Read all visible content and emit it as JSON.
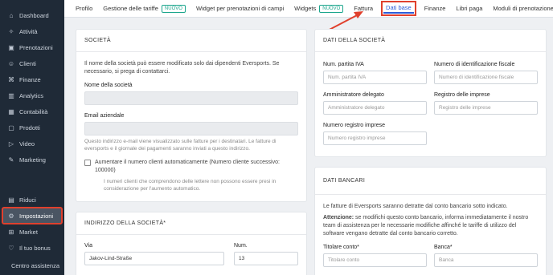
{
  "sidebar": {
    "items": [
      {
        "icon": "dashboard-icon",
        "glyph": "⌂",
        "label": "Dashboard"
      },
      {
        "icon": "activity-icon",
        "glyph": "✧",
        "label": "Attività"
      },
      {
        "icon": "calendar-icon",
        "glyph": "▣",
        "label": "Prenotazioni"
      },
      {
        "icon": "user-icon",
        "glyph": "☺",
        "label": "Clienti"
      },
      {
        "icon": "bank-icon",
        "glyph": "⌘",
        "label": "Finanze"
      },
      {
        "icon": "chart-icon",
        "glyph": "▥",
        "label": "Analytics"
      },
      {
        "icon": "calculator-icon",
        "glyph": "▦",
        "label": "Contabilità"
      },
      {
        "icon": "box-icon",
        "glyph": "▢",
        "label": "Prodotti"
      },
      {
        "icon": "play-icon",
        "glyph": "▷",
        "label": "Video"
      },
      {
        "icon": "megaphone-icon",
        "glyph": "✎",
        "label": "Marketing"
      }
    ],
    "bottom_items": [
      {
        "icon": "document-icon",
        "glyph": "▤",
        "label": "Riduci"
      },
      {
        "icon": "gear-icon",
        "glyph": "⚙",
        "label": "Impostazioni"
      },
      {
        "icon": "cart-icon",
        "glyph": "⊞",
        "label": "Market"
      },
      {
        "icon": "heart-icon",
        "glyph": "♡",
        "label": "Il tuo bonus"
      }
    ],
    "footer": "Centro assistenza"
  },
  "tabs": [
    {
      "label": "Profilo"
    },
    {
      "label": "Gestione delle tariffe",
      "badge": "NUOVO"
    },
    {
      "label": "Widget per prenotazioni di campi"
    },
    {
      "label": "Widgets",
      "badge": "NUOVO"
    },
    {
      "label": "Fattura"
    },
    {
      "label": "Dati base",
      "active": true
    },
    {
      "label": "Finanze"
    },
    {
      "label": "Libri paga"
    },
    {
      "label": "Moduli di prenotazione e offerte"
    }
  ],
  "company": {
    "title": "SOCIETÀ",
    "intro": "Il nome della società può essere modificato solo dai dipendenti Eversports. Se necessario, si prega di contattarci.",
    "name_label": "Nome della società",
    "email_label": "Email aziendale",
    "email_help": "Questo indirizzo e-mail viene visualizzato sulle fatture per i destinatari. Le fatture di eversports e il giornale dei pagamenti saranno inviati a questo indirizzo.",
    "auto_number_label": "Aumentare il numero clienti automaticamente (Numero cliente successivo: 100000)",
    "auto_number_help": "I numeri clienti che comprendono delle lettere non possono essere presi in considerazione per l'aumento automatico."
  },
  "address": {
    "title": "INDIRIZZO DELLA SOCIETÀ*",
    "street_label": "Via",
    "street_value": "Jakov-Lind-Straße",
    "number_label": "Num.",
    "number_value": "13"
  },
  "company_data": {
    "title": "DATI DELLA SOCIETÀ",
    "vat_label": "Num. partita IVA",
    "vat_placeholder": "Num. partita IVA",
    "tax_label": "Numero di identificazione fiscale",
    "tax_placeholder": "Numero di identificazione fiscale",
    "admin_label": "Amministratore delegato",
    "admin_placeholder": "Amministratore delegato",
    "register_label": "Registro delle imprese",
    "register_placeholder": "Registro delle imprese",
    "register_no_label": "Numero registro imprese",
    "register_no_placeholder": "Numero registro imprese"
  },
  "bank": {
    "title": "DATI BANCARI",
    "intro": "Le fatture di Eversports saranno detratte dal conto bancario sotto indicato.",
    "warning_prefix": "Attenzione:",
    "warning": " se modifichi questo conto bancario, informa immediatamente il nostro team di assistenza per le necessarie modifiche affinché le tariffe di utilizzo del software vengano detratte dal conto bancario corretto.",
    "holder_label": "Titolare conto*",
    "holder_placeholder": "Titolare conto",
    "bank_label": "Banca*",
    "bank_placeholder": "Banca"
  },
  "colors": {
    "sidebar": "#1f2a37",
    "accent": "#2b5bd7",
    "highlight": "#e0402d",
    "badge": "#1aa58c"
  }
}
